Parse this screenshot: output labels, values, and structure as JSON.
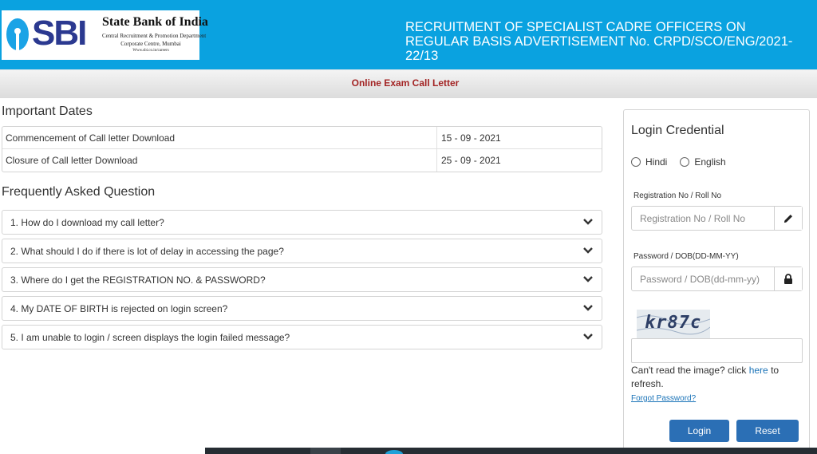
{
  "header": {
    "logo_text": "SBI",
    "bank_name": "State Bank of India",
    "bank_dept": "Central Recruitment & Promotion Department",
    "bank_office": "Corporate Centre, Mumbai",
    "bank_web": "Www.sbi.co.in/careers",
    "title": "RECRUITMENT OF SPECIALIST CADRE OFFICERS ON REGULAR BASIS ADVERTISEMENT No. CRPD/SCO/ENG/2021-22/13",
    "colors": {
      "header_bg": "#0aa2e0",
      "logo_blue": "#2b3990"
    }
  },
  "subbar": {
    "title": "Online Exam Call Letter"
  },
  "important_dates": {
    "heading": "Important Dates",
    "rows": [
      {
        "label": "Commencement of Call letter Download",
        "value": "15 - 09 - 2021"
      },
      {
        "label": "Closure of Call letter Download",
        "value": "25 - 09 - 2021"
      }
    ]
  },
  "faq": {
    "heading": "Frequently Asked Question",
    "items": [
      {
        "question": "1. How do I download my call letter?"
      },
      {
        "question": "2. What should I do if there is lot of delay in accessing the page?"
      },
      {
        "question": "3. Where do I get the REGISTRATION NO. & PASSWORD?"
      },
      {
        "question": "4. My DATE OF BIRTH is rejected on login screen?"
      },
      {
        "question": "5. I am unable to login / screen displays the login failed message?"
      }
    ]
  },
  "login": {
    "title": "Login Credential",
    "language_options": [
      "Hindi",
      "English"
    ],
    "registration_label": "Registration No / Roll No",
    "registration_placeholder": "Registration No / Roll No",
    "registration_value": "",
    "password_label": "Password / DOB(DD-MM-YY)",
    "password_placeholder": "Password / DOB(dd-mm-yy)",
    "password_value": "",
    "captcha_text": "kr87c",
    "captcha_value": "",
    "refresh_prefix": "Can't read the image? click ",
    "refresh_link": "here",
    "refresh_suffix": " to refresh.",
    "forgot_password": "Forgot Password?",
    "login_button": "Login",
    "reset_button": "Reset",
    "colors": {
      "button_bg": "#2b6fb5",
      "link": "#1a73b8"
    }
  }
}
